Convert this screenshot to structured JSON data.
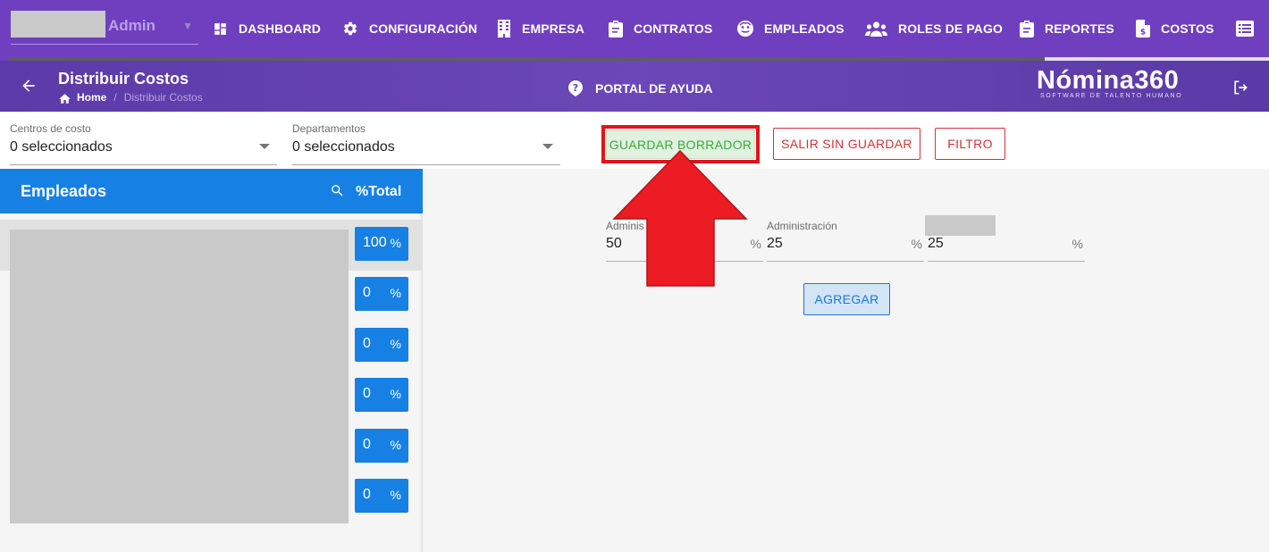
{
  "nav": {
    "user_role": "Admin",
    "items": [
      {
        "label": "DASHBOARD",
        "icon": "dashboard-icon"
      },
      {
        "label": "CONFIGURACIÓN",
        "icon": "gear-icon"
      },
      {
        "label": "EMPRESA",
        "icon": "building-icon"
      },
      {
        "label": "CONTRATOS",
        "icon": "clipboard-icon"
      },
      {
        "label": "EMPLEADOS",
        "icon": "face-icon"
      },
      {
        "label": "ROLES DE PAGO",
        "icon": "users-icon"
      },
      {
        "label": "REPORTES",
        "icon": "clipboard-icon"
      },
      {
        "label": "COSTOS",
        "icon": "file-dollar-icon"
      }
    ]
  },
  "header": {
    "title": "Distribuir Costos",
    "breadcrumb": {
      "home": "Home",
      "separator": "/",
      "current": "Distribuir Costos"
    },
    "help_portal": "PORTAL DE AYUDA",
    "brand_name": "Nómina360",
    "brand_tagline": "SOFTWARE DE TALENTO HUMANO"
  },
  "filters": {
    "cost_centers": {
      "label": "Centros de costo",
      "value": "0 seleccionados"
    },
    "departments": {
      "label": "Departamentos",
      "value": "0 seleccionados"
    }
  },
  "actions": {
    "save_draft": "GUARDAR BORRADOR",
    "exit_without_saving": "SALIR SIN GUARDAR",
    "filter": "FILTRO",
    "add": "AGREGAR"
  },
  "employees": {
    "title": "Empleados",
    "total_label": "%Total",
    "rows": [
      {
        "pct": "100",
        "unit": "%"
      },
      {
        "pct": "0",
        "unit": "%"
      },
      {
        "pct": "0",
        "unit": "%"
      },
      {
        "pct": "0",
        "unit": "%"
      },
      {
        "pct": "0",
        "unit": "%"
      },
      {
        "pct": "0",
        "unit": "%"
      }
    ]
  },
  "distribution": [
    {
      "label": "Adminis",
      "value": "50",
      "unit": "%"
    },
    {
      "label": "Administración",
      "value": "25",
      "unit": "%"
    },
    {
      "label": "",
      "value": "25",
      "unit": "%"
    }
  ],
  "colors": {
    "nav_bg": "#6f3fc0",
    "primary_blue": "#1780e4",
    "danger_red": "#d2343a",
    "success_green": "#3aaa3a",
    "highlight_red": "#e2131b"
  }
}
